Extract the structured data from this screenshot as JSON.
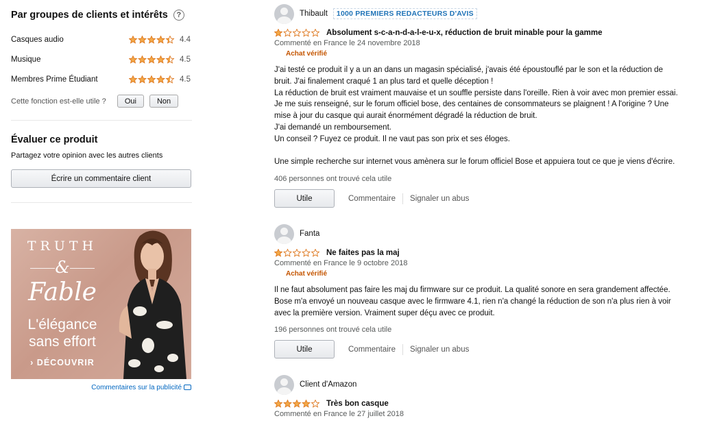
{
  "left": {
    "groups_title": "Par groupes de clients et intérêts",
    "help_glyph": "?",
    "ratings": [
      {
        "label": "Casques audio",
        "value": "4.4",
        "stars": 4.4
      },
      {
        "label": "Musique",
        "value": "4.5",
        "stars": 4.5
      },
      {
        "label": "Membres Prime Étudiant",
        "value": "4.5",
        "stars": 4.5
      }
    ],
    "useful_question": "Cette fonction est-elle utile ?",
    "yes_label": "Oui",
    "no_label": "Non",
    "evaluate_title": "Évaluer ce produit",
    "evaluate_sub": "Partagez votre opinion avec les autres clients",
    "write_review_label": "Écrire un commentaire client"
  },
  "ad": {
    "brand_line1": "TRUTH",
    "brand_amp": "&",
    "brand_line2": "Fable",
    "tagline1": "L'élégance",
    "tagline2": "sans effort",
    "cta": "› DÉCOUVRIR",
    "feedback": "Commentaires sur la publicité"
  },
  "reviews": [
    {
      "name": "Thibault",
      "badge": "1000 PREMIERS REDACTEURS D'AVIS",
      "stars": 1,
      "title": "Absolument s-c-a-n-d-a-l-e-u-x, réduction de bruit minable pour la gamme",
      "meta": "Commenté en France le 24 novembre 2018",
      "verified": "Achat vérifié",
      "body": [
        "J'ai testé ce produit il y a un an dans un magasin spécialisé, j'avais été époustouflé par le son et la réduction de",
        "bruit. J'ai finalement craqué 1 an plus tard et quelle déception !",
        "La réduction de bruit est vraiment mauvaise et un souffle persiste dans l'oreille. Rien à voir avec mon premier essai.",
        "Je me suis renseigné, sur le forum officiel bose, des centaines de consommateurs se plaignent ! A l'origine ? Une",
        "mise à jour du casque qui aurait énormément dégradé la réduction de bruit.",
        "J'ai demandé un remboursement.",
        "Un conseil ? Fuyez ce produit. Il ne vaut pas son prix et ses éloges.",
        "",
        "Une simple recherche sur internet vous amènera sur le forum officiel Bose et appuiera tout ce que je viens d'écrire."
      ],
      "helpful": "406 personnes ont trouvé cela utile",
      "useful_btn": "Utile",
      "comment": "Commentaire",
      "report": "Signaler un abus"
    },
    {
      "name": "Fanta",
      "badge": "",
      "stars": 1,
      "title": "Ne faites pas la maj",
      "meta": "Commenté en France le 9 octobre 2018",
      "verified": "Achat vérifié",
      "body": [
        "Il ne faut absolument pas faire les maj du firmware sur ce produit. La qualité sonore en sera grandement affectée.",
        "Bose m'a envoyé un nouveau casque avec le firmware 4.1, rien n'a changé la réduction de son n'a plus rien à voir",
        "avec la première version. Vraiment super déçu avec ce produit."
      ],
      "helpful": "196 personnes ont trouvé cela utile",
      "useful_btn": "Utile",
      "comment": "Commentaire",
      "report": "Signaler un abus"
    },
    {
      "name": "Client d'Amazon",
      "badge": "",
      "stars": 4,
      "title": "Très bon casque",
      "meta": "Commenté en France le 27 juillet 2018",
      "verified": "",
      "body": [],
      "helpful": "",
      "useful_btn": "",
      "comment": "",
      "report": ""
    }
  ],
  "colors": {
    "star": "#f3a847",
    "star_outline": "#de7921",
    "link": "#0066c0",
    "verified": "#c45500"
  }
}
